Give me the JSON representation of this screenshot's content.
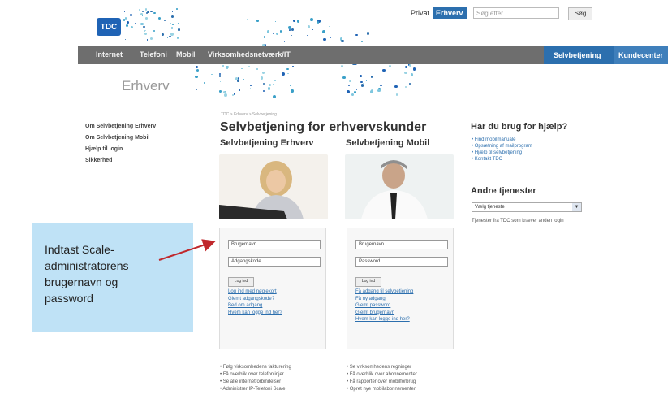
{
  "header": {
    "logo": "TDC",
    "privat": "Privat",
    "erhverv": "Erhverv",
    "search_placeholder": "Søg efter",
    "search_button": "Søg"
  },
  "topnav": {
    "left": [
      "Internet",
      "Telefoni",
      "Mobil",
      "Virksomhedsnetværk/IT"
    ],
    "right": [
      "Selvbetjening",
      "Kundecenter"
    ]
  },
  "brand": "Erhverv",
  "leftnav": [
    "Om Selvbetjening Erhverv",
    "Om Selvbetjening Mobil",
    "Hjælp til login",
    "Sikkerhed"
  ],
  "breadcrumb": "TDC > Erhverv > Selvbetjening",
  "title": "Selvbetjening for erhvervskunder",
  "left_panel": {
    "heading": "Selvbetjening Erhverv",
    "username": "Brugernavn",
    "password": "Adgangskode",
    "button": "Log ind",
    "links": [
      "Log ind med nøglekort",
      "Glemt adgangskode?",
      "Bed om adgang",
      "Hvem kan logge ind her?"
    ],
    "bullets": [
      "• Følg virksomhedens fakturering",
      "• Få overblik over telefonlinjer",
      "• Se alle internetforbindelser",
      "• Administrer IP-Telefoni Scale"
    ]
  },
  "right_panel": {
    "heading": "Selvbetjening Mobil",
    "username": "Brugernavn",
    "password": "Password",
    "button": "Log ind",
    "links": [
      "Få adgang til selvbetjening",
      "Få ny adgang",
      "Glemt password",
      "Glemt brugernavn",
      "Hvem kan logge ind her?"
    ],
    "bullets": [
      "• Se virksomhedens regninger",
      "• Få overblik over abonnementer",
      "• Få rapporter over mobilforbrug",
      "• Opret nye mobilabonnementer"
    ]
  },
  "right_sidebar": {
    "help_heading": "Har du brug for hjælp?",
    "help_links": [
      "• Find mobilmanuale",
      "• Opsætning af mailprogram",
      "• Hjælp til selvbetjening",
      "• Kontakt TDC"
    ],
    "services_heading": "Andre tjenester",
    "select_value": "Vælg tjeneste",
    "services_text": "Tjenester fra TDC som kræver anden login"
  },
  "callout": {
    "lines": [
      "Indtast Scale-",
      "administratorens",
      "brugernavn og",
      "password"
    ]
  },
  "colors": {
    "accent": "#2c6fae",
    "nav": "#6e6e6e",
    "callout": "#bfe2f6",
    "arrow": "#c0282c"
  }
}
